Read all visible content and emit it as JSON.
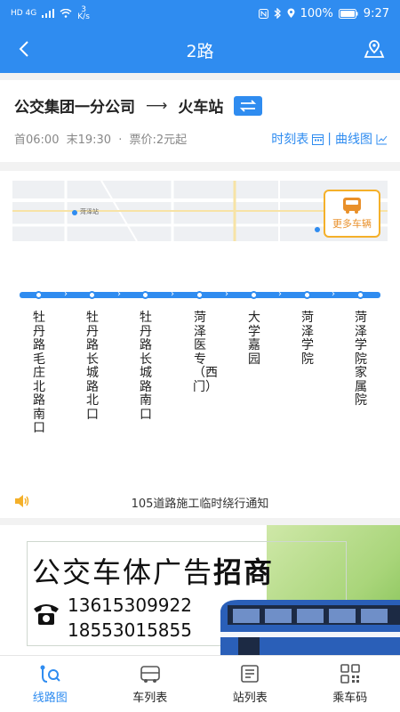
{
  "status": {
    "net": "HD 4G",
    "speed_value": "3",
    "speed_unit": "K/s",
    "battery": "100%",
    "time": "9:27"
  },
  "header": {
    "title": "2路"
  },
  "route": {
    "from": "公交集团一分公司",
    "to": "火车站",
    "first_bus": "首06:00",
    "last_bus": "末19:30",
    "fare": "票价:2元起",
    "timetable_label": "时刻表",
    "curve_label": "曲线图"
  },
  "map": {
    "more_vehicles_label": "更多车辆",
    "station_label": "菏泽站"
  },
  "stops": [
    "牡丹路毛庄北路南口",
    "牡丹路长城路北口",
    "牡丹路长城路南口",
    "菏泽医专（西门）",
    "大学嘉园",
    "菏泽学院",
    "菏泽学院家属院"
  ],
  "notice": {
    "text": "105道路施工临时绕行通知"
  },
  "ad": {
    "headline_normal": "公交车体广告",
    "headline_bold": "招商",
    "phone1": "13615309922",
    "phone2": "18553015855"
  },
  "tabs": [
    {
      "label": "线路图",
      "icon": "route-map-icon",
      "active": true
    },
    {
      "label": "车列表",
      "icon": "bus-list-icon",
      "active": false
    },
    {
      "label": "站列表",
      "icon": "station-list-icon",
      "active": false
    },
    {
      "label": "乘车码",
      "icon": "qr-code-icon",
      "active": false
    }
  ],
  "colors": {
    "primary": "#2f8cf0",
    "accent": "#f4b02a"
  }
}
